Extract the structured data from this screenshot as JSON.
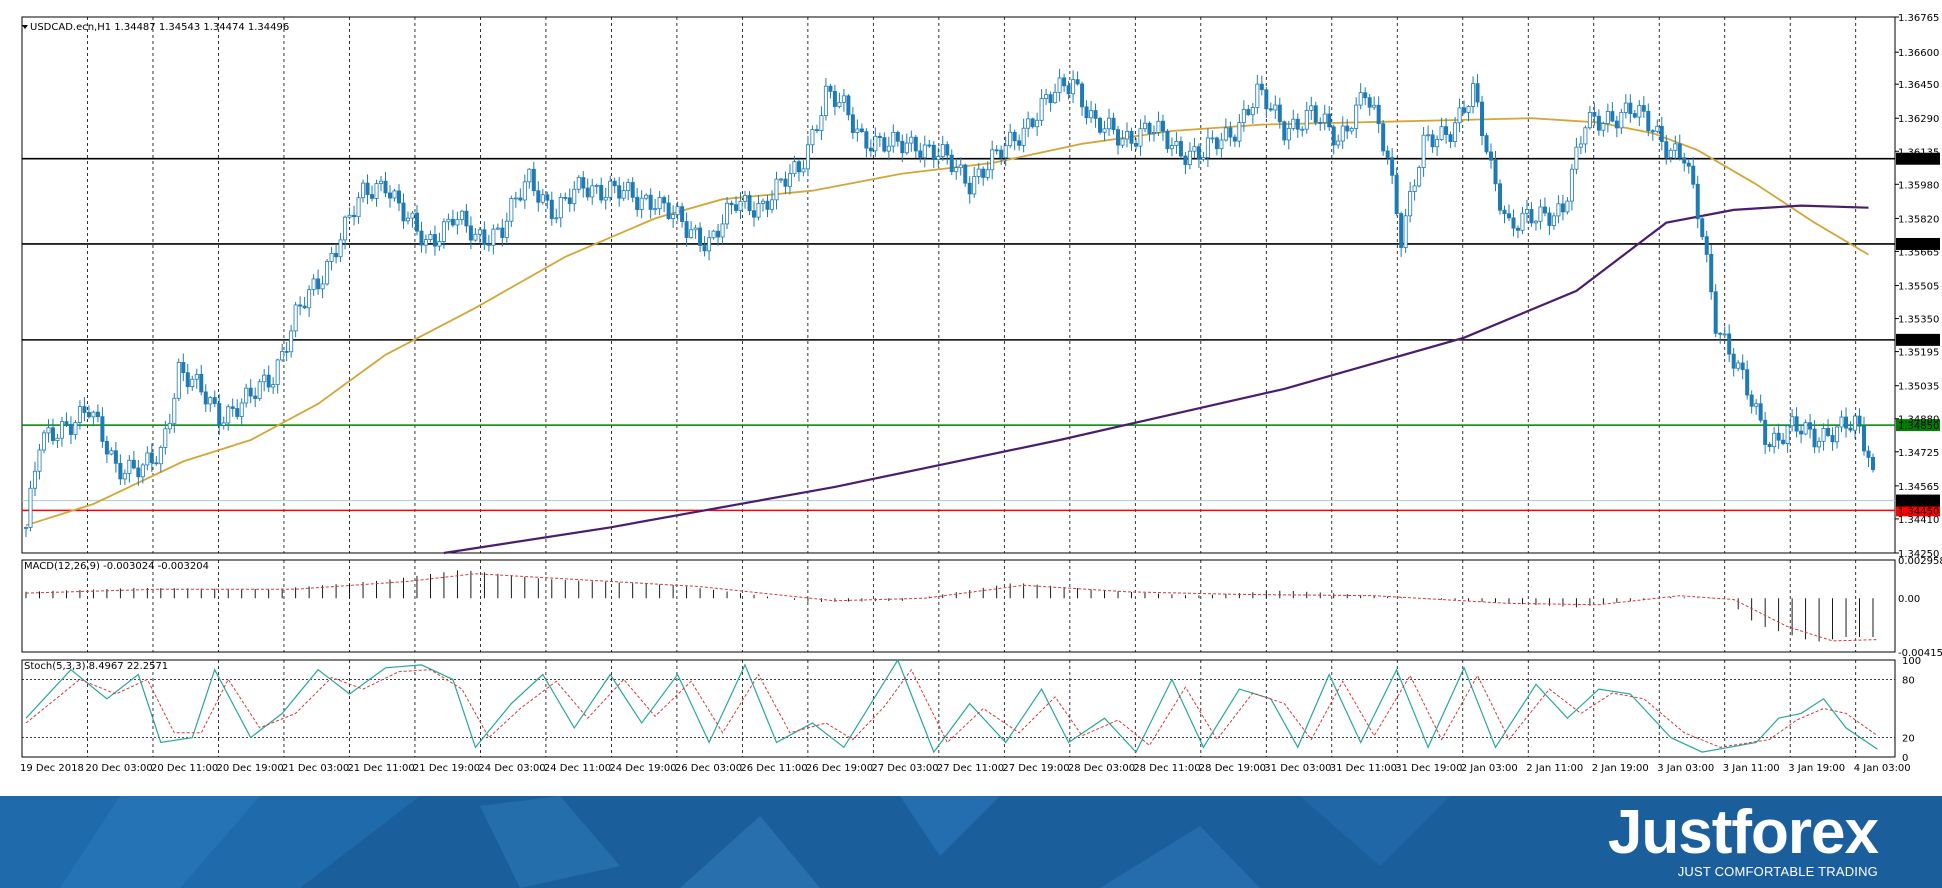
{
  "chart_data": [
    {
      "type": "candlestick",
      "symbol_header": "USDCAD.ecn,H1  1.34487 1.34543 1.34474 1.34496",
      "ylim": [
        1.3425,
        1.36765
      ],
      "y_ticks": [
        "1.36765",
        "1.36600",
        "1.36450",
        "1.36290",
        "1.36135",
        "1.35980",
        "1.35820",
        "1.35665",
        "1.35505",
        "1.35350",
        "1.35195",
        "1.35035",
        "1.34880",
        "1.34725",
        "1.34565",
        "1.34410",
        "1.34250"
      ],
      "x_labels": [
        "19 Dec 2018",
        "20 Dec 03:00",
        "20 Dec 11:00",
        "20 Dec 19:00",
        "21 Dec 03:00",
        "21 Dec 11:00",
        "21 Dec 19:00",
        "24 Dec 03:00",
        "24 Dec 11:00",
        "24 Dec 19:00",
        "26 Dec 03:00",
        "26 Dec 11:00",
        "26 Dec 19:00",
        "27 Dec 03:00",
        "27 Dec 11:00",
        "27 Dec 19:00",
        "28 Dec 03:00",
        "28 Dec 11:00",
        "28 Dec 19:00",
        "31 Dec 03:00",
        "31 Dec 11:00",
        "31 Dec 19:00",
        "2 Jan 03:00",
        "2 Jan 11:00",
        "2 Jan 19:00",
        "3 Jan 03:00",
        "3 Jan 11:00",
        "3 Jan 19:00",
        "4 Jan 03:00"
      ],
      "horizontal_levels": [
        {
          "label": "1.36100",
          "value": 1.361,
          "color": "#000000"
        },
        {
          "label": "1.35700",
          "value": 1.357,
          "color": "#000000"
        },
        {
          "label": "1.35250",
          "value": 1.3525,
          "color": "#000000"
        },
        {
          "label": "1.34850",
          "value": 1.3485,
          "color": "#008000"
        },
        {
          "label": "1.34450",
          "value": 1.3445,
          "color": "#ff0000"
        }
      ],
      "current_price": {
        "label": "1.34496",
        "value": 1.34496
      },
      "close_path": [
        [
          0,
          1.3437
        ],
        [
          3,
          1.3475
        ],
        [
          8,
          1.3485
        ],
        [
          14,
          1.3491
        ],
        [
          20,
          1.3467
        ],
        [
          26,
          1.3463
        ],
        [
          30,
          1.3472
        ],
        [
          34,
          1.3512
        ],
        [
          38,
          1.3502
        ],
        [
          43,
          1.349
        ],
        [
          50,
          1.3497
        ],
        [
          55,
          1.3509
        ],
        [
          60,
          1.3536
        ],
        [
          65,
          1.3551
        ],
        [
          70,
          1.3575
        ],
        [
          75,
          1.3592
        ],
        [
          80,
          1.36
        ],
        [
          85,
          1.358
        ],
        [
          89,
          1.357
        ],
        [
          95,
          1.3583
        ],
        [
          100,
          1.3572
        ],
        [
          106,
          1.3578
        ],
        [
          112,
          1.36
        ],
        [
          118,
          1.3585
        ],
        [
          124,
          1.3597
        ],
        [
          130,
          1.3596
        ],
        [
          136,
          1.359
        ],
        [
          140,
          1.3592
        ],
        [
          147,
          1.3576
        ],
        [
          152,
          1.3572
        ],
        [
          158,
          1.3588
        ],
        [
          164,
          1.3589
        ],
        [
          172,
          1.3605
        ],
        [
          178,
          1.364
        ],
        [
          182,
          1.3633
        ],
        [
          186,
          1.3621
        ],
        [
          192,
          1.3615
        ],
        [
          198,
          1.3618
        ],
        [
          204,
          1.361
        ],
        [
          210,
          1.36
        ],
        [
          216,
          1.361
        ],
        [
          222,
          1.3625
        ],
        [
          228,
          1.3638
        ],
        [
          233,
          1.3648
        ],
        [
          238,
          1.3625
        ],
        [
          244,
          1.362
        ],
        [
          250,
          1.3624
        ],
        [
          256,
          1.3615
        ],
        [
          262,
          1.3612
        ],
        [
          268,
          1.3622
        ],
        [
          274,
          1.364
        ],
        [
          280,
          1.3625
        ],
        [
          286,
          1.363
        ],
        [
          292,
          1.362
        ],
        [
          298,
          1.364
        ],
        [
          303,
          1.3612
        ],
        [
          306,
          1.3575
        ],
        [
          311,
          1.3615
        ],
        [
          317,
          1.3625
        ],
        [
          322,
          1.364
        ],
        [
          326,
          1.3605
        ],
        [
          330,
          1.358
        ],
        [
          336,
          1.3581
        ],
        [
          342,
          1.3588
        ],
        [
          347,
          1.3625
        ],
        [
          352,
          1.363
        ],
        [
          357,
          1.3632
        ],
        [
          362,
          1.3625
        ],
        [
          366,
          1.3615
        ],
        [
          369,
          1.361
        ],
        [
          373,
          1.3575
        ],
        [
          376,
          1.3535
        ],
        [
          379,
          1.352
        ],
        [
          384,
          1.3495
        ],
        [
          388,
          1.3478
        ],
        [
          393,
          1.3483
        ],
        [
          398,
          1.348
        ],
        [
          402,
          1.3483
        ],
        [
          407,
          1.3484
        ],
        [
          410,
          1.3473
        ],
        [
          412,
          1.3451
        ]
      ],
      "ma_yellow": [
        [
          0,
          1.3438
        ],
        [
          15,
          1.3448
        ],
        [
          25,
          1.3458
        ],
        [
          35,
          1.3468
        ],
        [
          50,
          1.3478
        ],
        [
          65,
          1.3495
        ],
        [
          80,
          1.3518
        ],
        [
          100,
          1.354
        ],
        [
          120,
          1.3564
        ],
        [
          140,
          1.3582
        ],
        [
          155,
          1.3591
        ],
        [
          175,
          1.3595
        ],
        [
          195,
          1.3603
        ],
        [
          215,
          1.3608
        ],
        [
          235,
          1.3617
        ],
        [
          255,
          1.3623
        ],
        [
          275,
          1.3626
        ],
        [
          295,
          1.3627
        ],
        [
          315,
          1.3628
        ],
        [
          335,
          1.3629
        ],
        [
          350,
          1.3627
        ],
        [
          362,
          1.3622
        ],
        [
          372,
          1.3614
        ],
        [
          385,
          1.3598
        ],
        [
          398,
          1.358
        ],
        [
          410,
          1.3565
        ]
      ],
      "ma_purple": [
        [
          93,
          1.3425
        ],
        [
          130,
          1.3437
        ],
        [
          180,
          1.3456
        ],
        [
          230,
          1.3478
        ],
        [
          280,
          1.3502
        ],
        [
          320,
          1.3526
        ],
        [
          345,
          1.3548
        ],
        [
          365,
          1.358
        ],
        [
          380,
          1.3586
        ],
        [
          395,
          1.3588
        ],
        [
          410,
          1.3587
        ]
      ],
      "n_bars": 412
    },
    {
      "type": "histogram",
      "header": "MACD(12,26,9) -0.003024 -0.003204",
      "ylim": [
        -0.004157,
        0.002958
      ],
      "y_ticks": [
        "0.002958",
        "0.00",
        "-0.004157"
      ],
      "points": [
        [
          0,
          0.0005
        ],
        [
          25,
          0.0008
        ],
        [
          55,
          0.0007
        ],
        [
          80,
          0.0014
        ],
        [
          97,
          0.0022
        ],
        [
          115,
          0.0015
        ],
        [
          145,
          0.001
        ],
        [
          175,
          -0.0003
        ],
        [
          195,
          -0.0002
        ],
        [
          220,
          0.0012
        ],
        [
          240,
          0.0006
        ],
        [
          260,
          0.0002
        ],
        [
          280,
          0.0006
        ],
        [
          300,
          0.0002
        ],
        [
          320,
          -0.0002
        ],
        [
          345,
          -0.0007
        ],
        [
          365,
          0.0001
        ],
        [
          378,
          0.0
        ],
        [
          385,
          -0.002
        ],
        [
          398,
          -0.0034
        ],
        [
          405,
          -0.003
        ],
        [
          412,
          -0.003
        ]
      ],
      "signal": [
        [
          0,
          0.0004
        ],
        [
          30,
          0.0007
        ],
        [
          60,
          0.0007
        ],
        [
          85,
          0.0013
        ],
        [
          100,
          0.0019
        ],
        [
          125,
          0.0014
        ],
        [
          150,
          0.0009
        ],
        [
          180,
          -0.0002
        ],
        [
          200,
          0.0
        ],
        [
          222,
          0.001
        ],
        [
          245,
          0.0005
        ],
        [
          270,
          0.0003
        ],
        [
          300,
          0.0002
        ],
        [
          330,
          -0.0004
        ],
        [
          350,
          -0.0005
        ],
        [
          368,
          0.0002
        ],
        [
          380,
          -0.0001
        ],
        [
          392,
          -0.0022
        ],
        [
          402,
          -0.0033
        ],
        [
          412,
          -0.0032
        ]
      ]
    },
    {
      "type": "line",
      "header": "Stoch(5,3,3) 8.4967 22.2571",
      "ylim": [
        0,
        100
      ],
      "y_ticks": [
        "100",
        "80",
        "20",
        "0"
      ],
      "levels": [
        80,
        20
      ],
      "main": [
        [
          0,
          40
        ],
        [
          10,
          90
        ],
        [
          18,
          60
        ],
        [
          25,
          85
        ],
        [
          30,
          15
        ],
        [
          37,
          20
        ],
        [
          42,
          90
        ],
        [
          50,
          20
        ],
        [
          57,
          45
        ],
        [
          65,
          90
        ],
        [
          72,
          65
        ],
        [
          80,
          92
        ],
        [
          88,
          95
        ],
        [
          95,
          80
        ],
        [
          100,
          10
        ],
        [
          108,
          55
        ],
        [
          115,
          85
        ],
        [
          122,
          30
        ],
        [
          130,
          85
        ],
        [
          137,
          35
        ],
        [
          145,
          85
        ],
        [
          152,
          15
        ],
        [
          160,
          95
        ],
        [
          167,
          15
        ],
        [
          175,
          35
        ],
        [
          182,
          10
        ],
        [
          188,
          55
        ],
        [
          194,
          100
        ],
        [
          202,
          5
        ],
        [
          210,
          55
        ],
        [
          218,
          15
        ],
        [
          226,
          70
        ],
        [
          232,
          15
        ],
        [
          240,
          40
        ],
        [
          247,
          5
        ],
        [
          255,
          80
        ],
        [
          262,
          10
        ],
        [
          270,
          70
        ],
        [
          277,
          60
        ],
        [
          283,
          10
        ],
        [
          290,
          85
        ],
        [
          297,
          15
        ],
        [
          305,
          90
        ],
        [
          312,
          10
        ],
        [
          320,
          92
        ],
        [
          327,
          10
        ],
        [
          336,
          75
        ],
        [
          343,
          40
        ],
        [
          350,
          70
        ],
        [
          357,
          65
        ],
        [
          366,
          20
        ],
        [
          373,
          5
        ],
        [
          385,
          15
        ],
        [
          390,
          40
        ],
        [
          395,
          45
        ],
        [
          400,
          60
        ],
        [
          405,
          30
        ],
        [
          412,
          8
        ]
      ],
      "signal_line": [
        [
          0,
          35
        ],
        [
          12,
          80
        ],
        [
          20,
          65
        ],
        [
          27,
          80
        ],
        [
          33,
          25
        ],
        [
          39,
          25
        ],
        [
          45,
          80
        ],
        [
          52,
          30
        ],
        [
          60,
          45
        ],
        [
          68,
          82
        ],
        [
          75,
          70
        ],
        [
          83,
          88
        ],
        [
          90,
          90
        ],
        [
          97,
          70
        ],
        [
          103,
          20
        ],
        [
          110,
          50
        ],
        [
          118,
          78
        ],
        [
          125,
          40
        ],
        [
          133,
          80
        ],
        [
          140,
          42
        ],
        [
          148,
          78
        ],
        [
          155,
          25
        ],
        [
          163,
          85
        ],
        [
          170,
          25
        ],
        [
          178,
          35
        ],
        [
          184,
          18
        ],
        [
          191,
          52
        ],
        [
          197,
          90
        ],
        [
          205,
          15
        ],
        [
          213,
          50
        ],
        [
          221,
          25
        ],
        [
          229,
          62
        ],
        [
          235,
          22
        ],
        [
          243,
          38
        ],
        [
          250,
          12
        ],
        [
          258,
          72
        ],
        [
          265,
          18
        ],
        [
          273,
          66
        ],
        [
          280,
          55
        ],
        [
          286,
          18
        ],
        [
          293,
          78
        ],
        [
          300,
          22
        ],
        [
          308,
          84
        ],
        [
          315,
          18
        ],
        [
          323,
          84
        ],
        [
          330,
          18
        ],
        [
          339,
          70
        ],
        [
          346,
          45
        ],
        [
          353,
          66
        ],
        [
          360,
          60
        ],
        [
          369,
          25
        ],
        [
          377,
          10
        ],
        [
          388,
          18
        ],
        [
          394,
          38
        ],
        [
          400,
          50
        ],
        [
          405,
          45
        ],
        [
          412,
          22
        ]
      ]
    }
  ],
  "brand": {
    "logo": "Justforex",
    "tagline": "JUST COMFORTABLE TRADING"
  }
}
